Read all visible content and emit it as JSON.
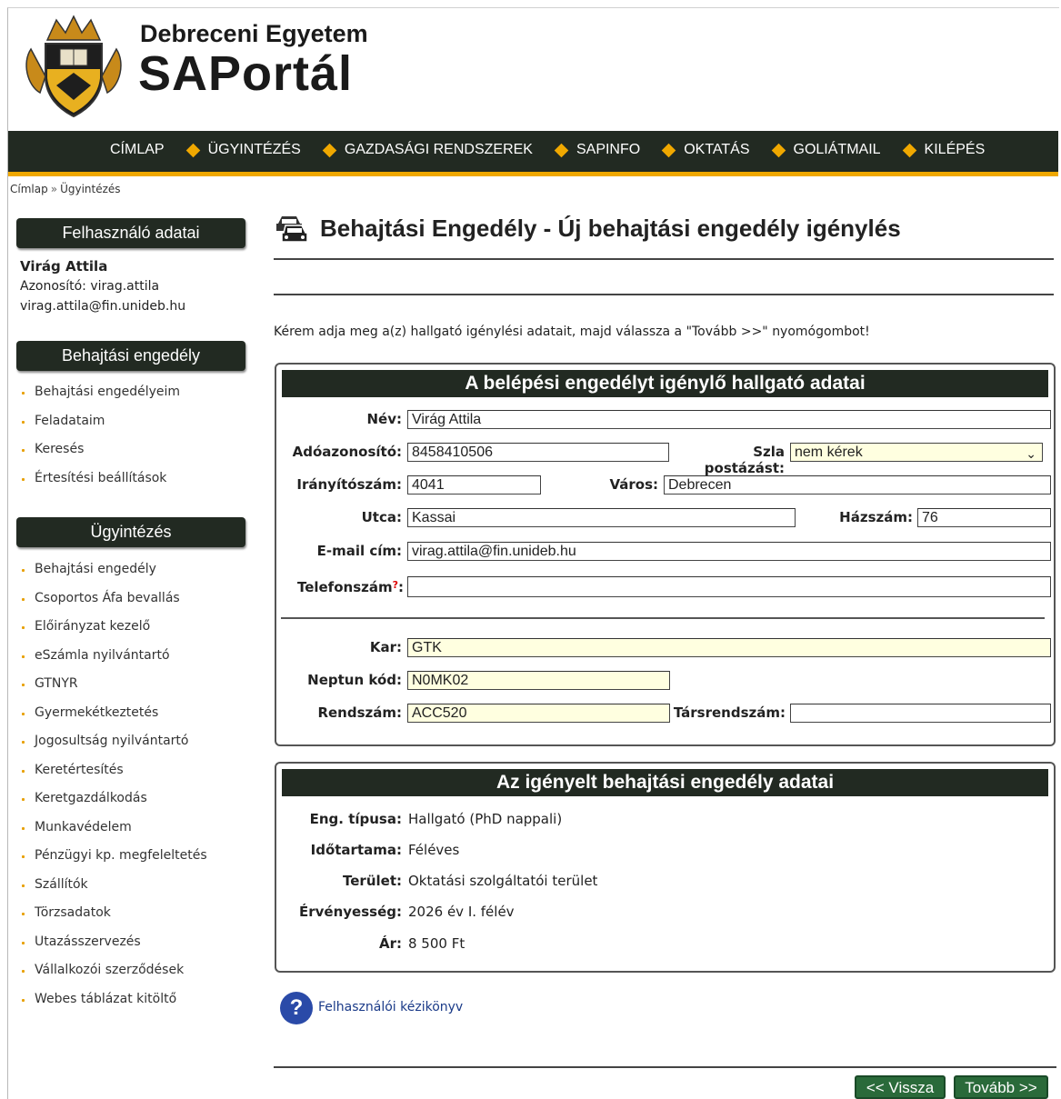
{
  "header": {
    "university": "Debreceni Egyetem",
    "portal_name": "SAPortál"
  },
  "nav": {
    "items": [
      "CÍMLAP",
      "ÜGYINTÉZÉS",
      "GAZDASÁGI RENDSZEREK",
      "SAPINFO",
      "OKTATÁS",
      "GOLIÁTMAIL",
      "KILÉPÉS"
    ]
  },
  "breadcrumb": {
    "home": "Címlap",
    "sep": "»",
    "current": "Ügyintézés"
  },
  "sidebar": {
    "user_box_title": "Felhasználó adatai",
    "user_name": "Virág Attila",
    "user_id": "Azonosító: virag.attila",
    "user_email": "virag.attila@fin.unideb.hu",
    "permit_box_title": "Behajtási engedély",
    "permit_items": [
      "Behajtási engedélyeim",
      "Feladataim",
      "Keresés",
      "Értesítési beállítások"
    ],
    "admin_box_title": "Ügyintézés",
    "admin_items": [
      "Behajtási engedély",
      "Csoportos Áfa bevallás",
      "Előirányzat kezelő",
      "eSzámla nyilvántartó",
      "GTNYR",
      "Gyermekétkeztetés",
      "Jogosultság nyilvántartó",
      "Keretértesítés",
      "Keretgazdálkodás",
      "Munkavédelem",
      "Pénzügyi kp. megfeleltetés",
      "Szállítók",
      "Törzsadatok",
      "Utazásszervezés",
      "Vállalkozói szerződések",
      "Webes táblázat kitöltő"
    ]
  },
  "main": {
    "title": "Behajtási Engedély - Új behajtási engedély igénylés",
    "instruction": "Kérem adja meg a(z) hallgató igénylési adatait, majd válassza a \"Tovább >>\" nyomógombot!",
    "student_panel": {
      "title": "A belépési engedélyt igénylő hallgató adatai",
      "labels": {
        "name": "Név:",
        "tax_id": "Adóazonosító:",
        "invoice_post": "Szla postázást:",
        "zip": "Irányítószám:",
        "city": "Város:",
        "street": "Utca:",
        "house_no": "Házszám:",
        "email": "E-mail cím:",
        "phone": "Telefonszám",
        "phone_colon": ":",
        "phone_req": "?",
        "faculty": "Kar:",
        "neptun": "Neptun kód:",
        "plate": "Rendszám:",
        "co_plate": "Társrendszám:"
      },
      "values": {
        "name": "Virág Attila",
        "tax_id": "8458410506",
        "invoice_post": "nem kérek",
        "zip": "4041",
        "city": "Debrecen",
        "street": "Kassai",
        "house_no": "76",
        "email": "virag.attila@fin.unideb.hu",
        "phone": "",
        "faculty": "GTK",
        "neptun": "N0MK02",
        "plate": "ACC520",
        "co_plate": ""
      }
    },
    "permit_panel": {
      "title": "Az igényelt behajtási engedély adatai",
      "rows": [
        {
          "label": "Eng. típusa:",
          "value": "Hallgató (PhD nappali)"
        },
        {
          "label": "Időtartama:",
          "value": "Féléves"
        },
        {
          "label": "Terület:",
          "value": "Oktatási szolgáltatói terület"
        },
        {
          "label": "Érvényesség:",
          "value": "2026 év I. félév"
        },
        {
          "label": "Ár:",
          "value": "8 500 Ft"
        }
      ]
    },
    "help_icon": "?",
    "help_link": "Felhasználói kézikönyv",
    "back_button": "<< Vissza",
    "next_button": "Tovább >>"
  },
  "colors": {
    "nav_bg": "#222a22",
    "accent": "#f0a800",
    "button": "#2a6a3a",
    "field_yellow": "#ffffe0"
  }
}
